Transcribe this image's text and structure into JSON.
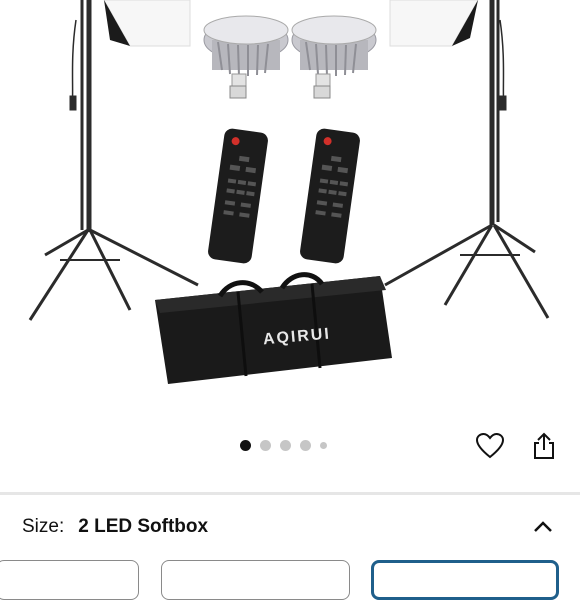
{
  "product": {
    "brand_text": "AQIRUI"
  },
  "carousel": {
    "page_count": 5,
    "active_index": 0
  },
  "size": {
    "label": "Size:",
    "value": "2 LED Softbox"
  },
  "colors": {
    "active_dot": "#111111",
    "inactive_dot": "#c6c6c6",
    "selected_option_border": "#1f5f8b"
  },
  "icons": [
    "heart-icon",
    "share-icon",
    "chevron-up-icon"
  ]
}
